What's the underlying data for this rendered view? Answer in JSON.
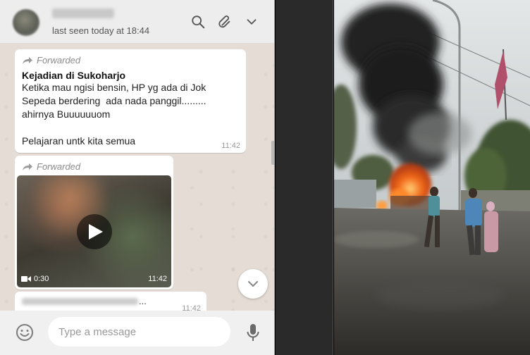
{
  "header": {
    "last_seen": "last seen today at 18:44"
  },
  "messages": [
    {
      "forwarded_label": "Forwarded",
      "title": "Kejadian di Sukoharjo",
      "lines": [
        "Ketika mau ngisi bensin, HP yg ada di Jok",
        "Sepeda berdering  ada nada panggil.........",
        "ahirnya Buuuuuuom",
        "",
        "Pelajaran untk kita semua"
      ],
      "time": "11:42"
    },
    {
      "forwarded_label": "Forwarded",
      "video_duration": "0:30",
      "time": "11:42"
    },
    {
      "ellipsis": "...",
      "time": "11:42"
    }
  ],
  "composer": {
    "placeholder": "Type a message"
  },
  "icons": {
    "search": "search-icon",
    "attach": "paperclip-icon",
    "menu": "chevron-down-icon",
    "scroll": "chevron-down-icon",
    "emoji": "smiley-icon",
    "mic": "microphone-icon",
    "forward": "forward-arrow-icon",
    "play": "play-icon",
    "video": "video-camera-icon"
  },
  "colors": {
    "chat_bg": "#e5ddd5",
    "bubble": "#ffffff",
    "header": "#ededed",
    "smoke": "#1e1e1e",
    "fire": "#f26a1b"
  }
}
